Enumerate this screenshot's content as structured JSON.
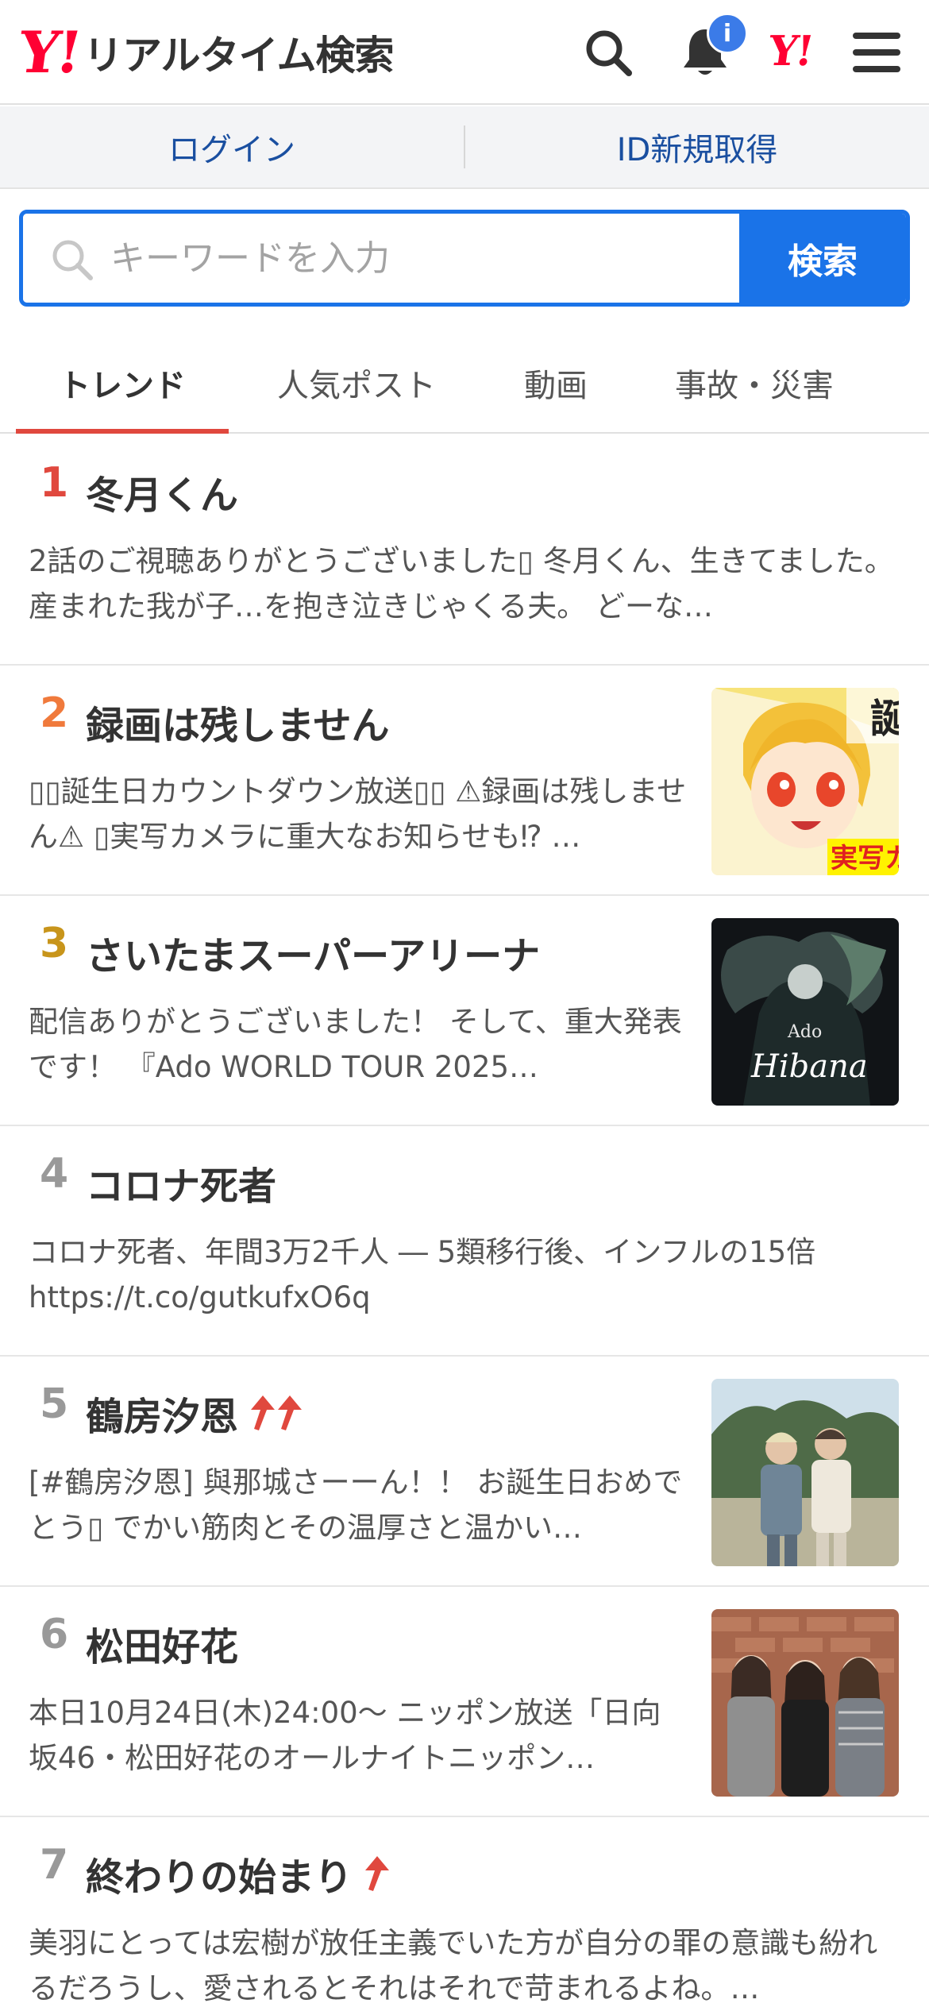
{
  "app": {
    "logo_mark": "Y!",
    "logo_text": "リアルタイム検索",
    "notification_badge": "i",
    "yahoo_mini": "Y!"
  },
  "login": {
    "login_label": "ログイン",
    "signup_label": "ID新規取得"
  },
  "search": {
    "placeholder": "キーワードを入力",
    "value": "",
    "button_label": "検索"
  },
  "tabs": [
    {
      "label": "トレンド",
      "active": true
    },
    {
      "label": "人気ポスト",
      "active": false
    },
    {
      "label": "動画",
      "active": false
    },
    {
      "label": "事故・災害",
      "active": false
    }
  ],
  "colors": {
    "accent_blue": "#1a73e8",
    "brand_red": "#ff0033",
    "rank1": "#e0483e",
    "rank2": "#f07a3c",
    "rank3": "#c8951b",
    "rank_other": "#999999",
    "trend_up": "#e0483e"
  },
  "trends": [
    {
      "rank": "1",
      "title": "冬月くん",
      "description": "2話のご視聴ありがとうございました▯ 冬月くん、生きてました。 産まれた我が子…を抱き泣きじゃくる夫。 どーな…",
      "thumbnail": null,
      "trend_arrows": 0
    },
    {
      "rank": "2",
      "title": "録画は残しません",
      "description": "▯▯誕生日カウントダウン放送▯▯ ⚠録画は残しません⚠ ▯実写カメラに重大なお知らせも⁉ …",
      "thumbnail": "anime-avatar",
      "thumbnail_text": "実写カ",
      "trend_arrows": 0
    },
    {
      "rank": "3",
      "title": "さいたまスーパーアリーナ",
      "description": "配信ありがとうございました！ そして、重大発表です！ 『Ado WORLD TOUR 2025…",
      "thumbnail": "album-art",
      "thumbnail_text": "Ado",
      "trend_arrows": 0
    },
    {
      "rank": "4",
      "title": "コロナ死者",
      "description": "コロナ死者、年間3万2千人 ― 5類移行後、インフルの15倍 https://t.co/gutkufxO6q",
      "thumbnail": null,
      "trend_arrows": 0
    },
    {
      "rank": "5",
      "title": "鶴房汐恩",
      "description": "[#鶴房汐恩] 與那城さーーん！！ お誕生日おめでとう▯ でかい筋肉とその温厚さと温かい…",
      "thumbnail": "photo-two-people",
      "trend_arrows": 2
    },
    {
      "rank": "6",
      "title": "松田好花",
      "description": "本日10月24日(木)24:00〜 ニッポン放送「日向坂46・松田好花のオールナイトニッポン…",
      "thumbnail": "photo-three-people",
      "trend_arrows": 0
    },
    {
      "rank": "7",
      "title": "終わりの始まり",
      "description": "美羽にとっては宏樹が放任主義でいた方が自分の罪の意識も紛れるだろうし、愛されるとそれはそれで苛まれるよね。…",
      "thumbnail": null,
      "trend_arrows": 1
    }
  ]
}
